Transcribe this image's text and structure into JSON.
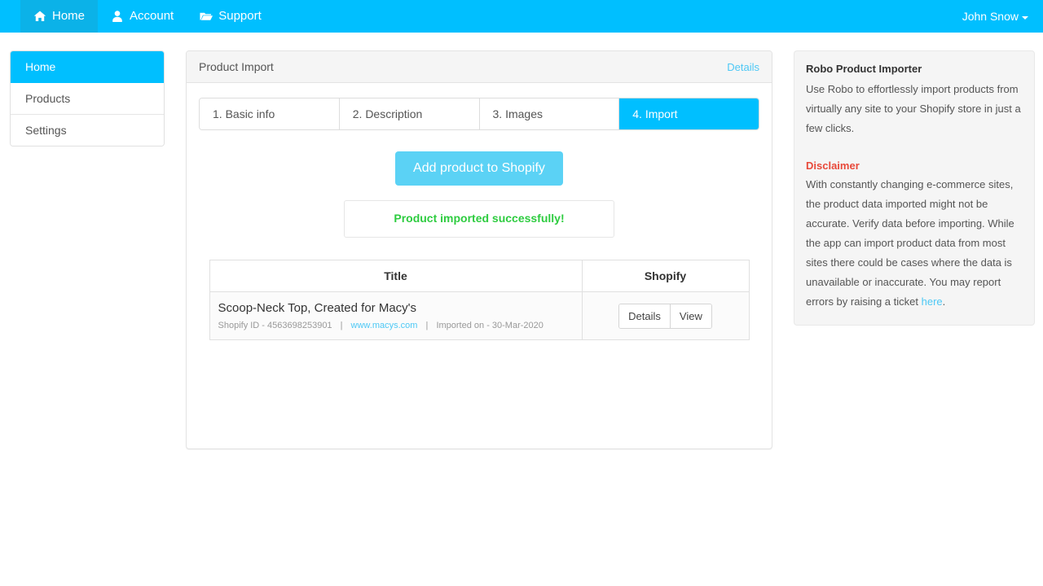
{
  "navbar": {
    "items": [
      {
        "label": "Home",
        "icon": "home-icon",
        "active": true
      },
      {
        "label": "Account",
        "icon": "user-icon",
        "active": false
      },
      {
        "label": "Support",
        "icon": "folder-open-icon",
        "active": false
      }
    ],
    "user": "John Snow",
    "brand_color": "#00bfff",
    "active_color": "#0bb2e8"
  },
  "sidebar": {
    "items": [
      {
        "label": "Home",
        "active": true
      },
      {
        "label": "Products",
        "active": false
      },
      {
        "label": "Settings",
        "active": false
      }
    ]
  },
  "main": {
    "card_title": "Product Import",
    "details_link": "Details",
    "steps": [
      {
        "label": "1. Basic info",
        "active": false
      },
      {
        "label": "2. Description",
        "active": false
      },
      {
        "label": "3. Images",
        "active": false
      },
      {
        "label": "4. Import",
        "active": true
      }
    ],
    "primary_button": "Add product to Shopify",
    "alert_message": "Product imported successfully!",
    "alert_color": "#2ecc40",
    "table": {
      "headers": [
        "Title",
        "Shopify"
      ],
      "rows": [
        {
          "title": "Scoop-Neck Top, Created for Macy's",
          "meta_id_label": "Shopify ID - 4563698253901",
          "meta_site": "www.macys.com",
          "meta_imported": "Imported on - 30-Mar-2020",
          "actions": [
            "Details",
            "View"
          ]
        }
      ]
    }
  },
  "aside": {
    "title": "Robo Product Importer",
    "description": "Use Robo to effortlessly import products from virtually any site to your Shopify store in just a few clicks.",
    "disclaimer_title": "Disclaimer",
    "disclaimer_color": "#e8493a",
    "disclaimer_body": "With constantly changing e-commerce sites, the product data imported might not be accurate. Verify data before importing. While the app can import product data from most sites there could be cases where the data is unavailable or inaccurate. You may report errors by raising a ticket ",
    "disclaimer_link": "here",
    "disclaimer_tail": "."
  }
}
